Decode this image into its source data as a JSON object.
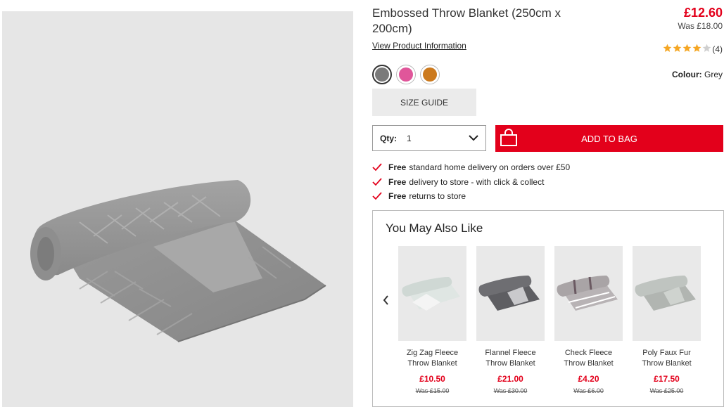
{
  "product": {
    "title": "Embossed Throw Blanket (250cm x 200cm)",
    "price": "£12.60",
    "was_price": "Was £18.00",
    "view_info_label": "View Product Information",
    "rating_count": "(4)",
    "rating_value": 4,
    "rating_max": 5,
    "colour_label": "Colour:",
    "colour_value": "Grey",
    "swatches": [
      {
        "name": "Grey",
        "color": "#7a7a7a",
        "selected": true
      },
      {
        "name": "Pink",
        "color": "#e0569a",
        "selected": false
      },
      {
        "name": "Mustard",
        "color": "#cc7a1e",
        "selected": false
      }
    ],
    "size_guide_label": "SIZE GUIDE",
    "qty_label": "Qty:",
    "qty_value": "1",
    "add_to_bag_label": "ADD TO BAG"
  },
  "benefits": [
    {
      "bold": "Free",
      "text": "standard home delivery on orders over £50"
    },
    {
      "bold": "Free",
      "text": "delivery to store - with click & collect"
    },
    {
      "bold": "Free",
      "text": "returns to store"
    }
  ],
  "also_like": {
    "heading": "You May Also Like",
    "items": [
      {
        "name": "Zig Zag Fleece Throw Blanket",
        "price": "£10.50",
        "was": "Was £15.00",
        "color": "#dfe6e3"
      },
      {
        "name": "Flannel Fleece Throw Blanket",
        "price": "£21.00",
        "was": "Was £30.00",
        "color": "#6e6e72"
      },
      {
        "name": "Check Fleece Throw Blanket",
        "price": "£4.20",
        "was": "Was £6.00",
        "color": "#a9a4a6"
      },
      {
        "name": "Poly Faux Fur Throw Blanket",
        "price": "£17.50",
        "was": "Was £25.00",
        "color": "#bfc4c0"
      }
    ]
  },
  "colors": {
    "accent_red": "#e3001b",
    "star_gold": "#f5a623"
  }
}
